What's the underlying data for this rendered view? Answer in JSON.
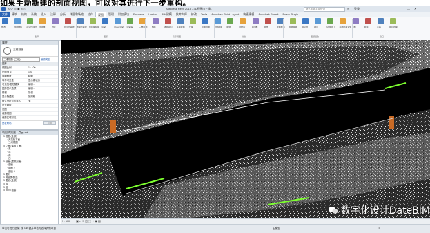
{
  "caption": "如果手动新建的剖面视图，可以对其进行下一步重构。",
  "titlebar": {
    "title": "Autodesk Revit 2018 - 3D视图: {三维}",
    "search_placeholder": "键入关键字或短语",
    "user": "登录"
  },
  "tabs": [
    "文件",
    "建筑",
    "结构",
    "系统",
    "插入",
    "注释",
    "分析",
    "体量和场地",
    "协作",
    "视图",
    "管理",
    "附加模块",
    "Enscape",
    "Lumion",
    "BIM建模",
    "族库大师",
    "修改",
    "Tekla",
    "Autodesk Point Layout",
    "快速建模",
    "Autodesk FormIt",
    "Fuzor Plugin"
  ],
  "active_tab": "视图",
  "ribbon": {
    "buttons": [
      "修改",
      "视图样板",
      "可见性/图形",
      "过滤器",
      "细线",
      "显示隐藏线",
      "删除隐藏线",
      "剖切面轮廓",
      "渲染",
      "Cloud渲染",
      "渲染库",
      "三维视图",
      "剖面",
      "详图索引",
      "平面视图",
      "立面",
      "绘图视图",
      "复制视图",
      "图例",
      "明细表",
      "范围框",
      "图纸",
      "视图参照",
      "导向轴网",
      "拼接线",
      "视口",
      "切换窗口",
      "关闭隐藏对象",
      "复制",
      "层叠",
      "平铺",
      "用户界面"
    ],
    "groups": [
      "选择",
      "图形",
      "演示视图",
      "创建",
      "图纸组合",
      "窗口"
    ]
  },
  "properties": {
    "title": "属性",
    "type_name": "三维视图",
    "selector_value": "三维视图: {三维}",
    "edit_type_label": "编辑类型",
    "section": "图形",
    "rows": [
      {
        "k": "视图比例",
        "v": "1 : 100"
      },
      {
        "k": "比例值 1:",
        "v": "100"
      },
      {
        "k": "详细程度",
        "v": "精细"
      },
      {
        "k": "零件可见性",
        "v": "显示原状态"
      },
      {
        "k": "可见性/图形替换",
        "v": "编辑..."
      },
      {
        "k": "图形显示选项",
        "v": "编辑..."
      },
      {
        "k": "规程",
        "v": "协调"
      },
      {
        "k": "显示隐藏线",
        "v": "按规程"
      },
      {
        "k": "默认分析显示样式",
        "v": "无"
      },
      {
        "k": "日光路径",
        "v": ""
      },
      {
        "k": "范围",
        "v": ""
      },
      {
        "k": "裁剪视图",
        "v": ""
      },
      {
        "k": "裁剪区域可见",
        "v": ""
      }
    ],
    "help_link": "属性帮助",
    "apply_button": "应用"
  },
  "browser": {
    "title": "项目浏览器 - 点云.rvt",
    "items": [
      "视图 (全部)",
      "天花板平面",
      "三维视图",
      "立面 (建筑立面)",
      "东",
      "北",
      "南",
      "西",
      "剖面 (建筑剖面)",
      "剖面 1",
      "剖面 2",
      "剖面 3",
      "图例",
      "明细表/数量",
      "图纸 (全部)",
      "族",
      "组",
      "Revit 链接"
    ]
  },
  "viewbar": {
    "scale": "1 : 100"
  },
  "statusbar": {
    "left_text": "单击可进行选择; 按 Tab 键并单击可选择其他项目",
    "model": "主模型",
    "coords": ":0"
  },
  "watermark": "数字化设计DateBIM",
  "colors": {
    "accent": "#2b63b5",
    "file_tab": "#2b63b5",
    "cloud_green": "#7dff2f",
    "orange": "#c86a25",
    "view_bg": "#000000"
  }
}
